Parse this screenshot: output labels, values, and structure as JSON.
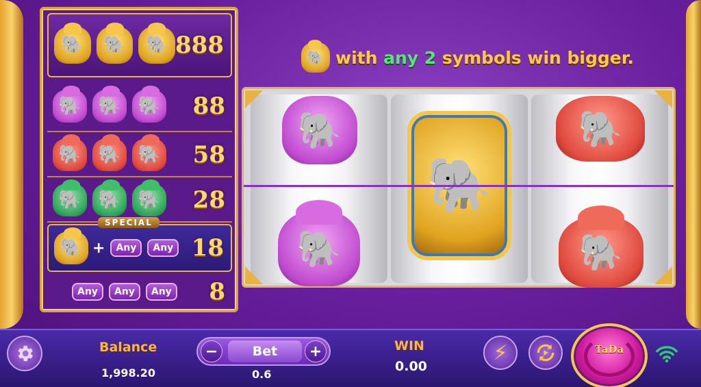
{
  "paytable": {
    "rows": [
      {
        "symbols": [
          "gold",
          "gold",
          "gold"
        ],
        "payout": "888"
      },
      {
        "symbols": [
          "purple",
          "purple",
          "purple"
        ],
        "payout": "88"
      },
      {
        "symbols": [
          "red",
          "red",
          "red"
        ],
        "payout": "58"
      },
      {
        "symbols": [
          "green",
          "green",
          "green"
        ],
        "payout": "28"
      },
      {
        "symbols": [
          "gold",
          "any",
          "any"
        ],
        "label": "SPECIAL",
        "payout": "18"
      },
      {
        "symbols": [
          "any",
          "any",
          "any"
        ],
        "payout": "8"
      }
    ],
    "any_label": "Any",
    "special_label": "SPECIAL",
    "plus": "+"
  },
  "headline": {
    "part1": "with ",
    "highlight": "any 2",
    "part2": " symbols win bigger."
  },
  "reels": [
    {
      "top": "purple",
      "bottom": "purple"
    },
    {
      "center": "gold"
    },
    {
      "top": "red",
      "bottom": "red"
    }
  ],
  "bottom_bar": {
    "balance_label": "Balance",
    "balance_value": "1,998.20",
    "bet_label": "Bet",
    "bet_value": "0.6",
    "minus": "−",
    "plus": "+",
    "win_label": "WIN",
    "win_value": "0.00",
    "spin_logo": "TaDa"
  },
  "icons": {
    "settings": "gear-icon",
    "turbo": "lightning-icon",
    "autoplay": "autoplay-icon",
    "connection": "wifi-icon"
  },
  "colors": {
    "gold_text": "#ffcb3c",
    "green_highlight": "#5ee07a",
    "wifi": "#2ecc71"
  }
}
